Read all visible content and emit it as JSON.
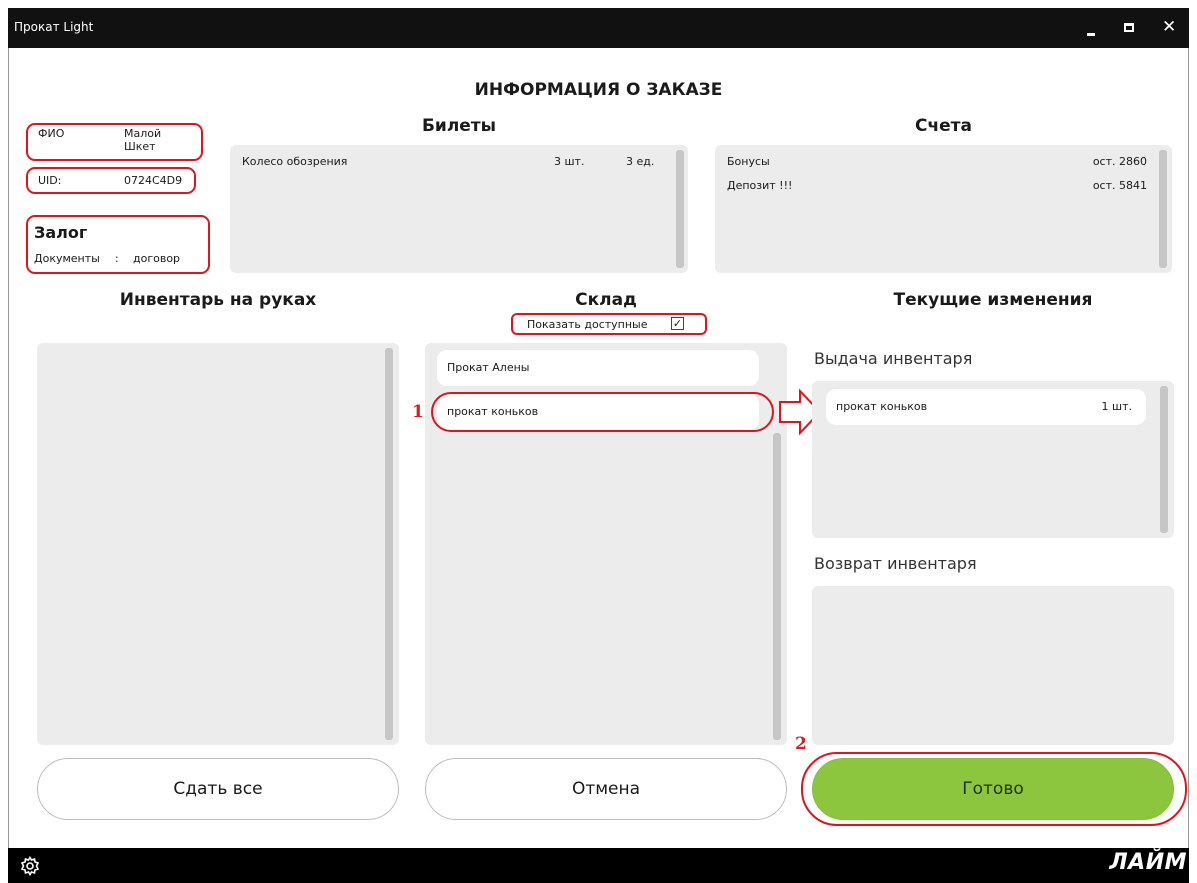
{
  "window": {
    "title": "Прокат Light"
  },
  "page": {
    "title": "ИНФОРМАЦИЯ О ЗАКАЗЕ"
  },
  "client": {
    "name_label": "ФИО",
    "name_value": "Малой Шкет",
    "uid_label": "UID:",
    "uid_value": "0724C4D9"
  },
  "deposit": {
    "title": "Залог",
    "doc_label": "Документы",
    "separator": ":",
    "doc_value": "договор"
  },
  "tickets": {
    "title": "Билеты",
    "items": [
      {
        "name": "Колесо обозрения",
        "qty": "3 шт.",
        "units": "3 ед."
      }
    ]
  },
  "accounts": {
    "title": "Счета",
    "items": [
      {
        "name": "Бонусы",
        "rest": "ост. 2860"
      },
      {
        "name": "Депозит !!!",
        "rest": "ост. 5841"
      }
    ]
  },
  "inventory_in_hands": {
    "title": "Инвентарь на руках"
  },
  "warehouse": {
    "title": "Склад",
    "show_available_label": "Показать доступные",
    "show_available_checked": true,
    "items": [
      {
        "name": "Прокат Алены"
      },
      {
        "name": "прокат коньков"
      }
    ]
  },
  "changes": {
    "title": "Текущие изменения",
    "issue_title": "Выдача инвентаря",
    "issue_items": [
      {
        "name": "прокат коньков",
        "qty": "1 шт."
      }
    ],
    "return_title": "Возврат инвентаря"
  },
  "buttons": {
    "return_all": "Сдать все",
    "cancel": "Отмена",
    "done": "Готово"
  },
  "annotations": {
    "step1": "1",
    "step2": "2"
  },
  "footer": {
    "logo": "ЛАЙМ"
  },
  "colors": {
    "accent_green": "#8cc63e",
    "annotation_red": "#e0141c",
    "panel_gray": "#ececec"
  }
}
